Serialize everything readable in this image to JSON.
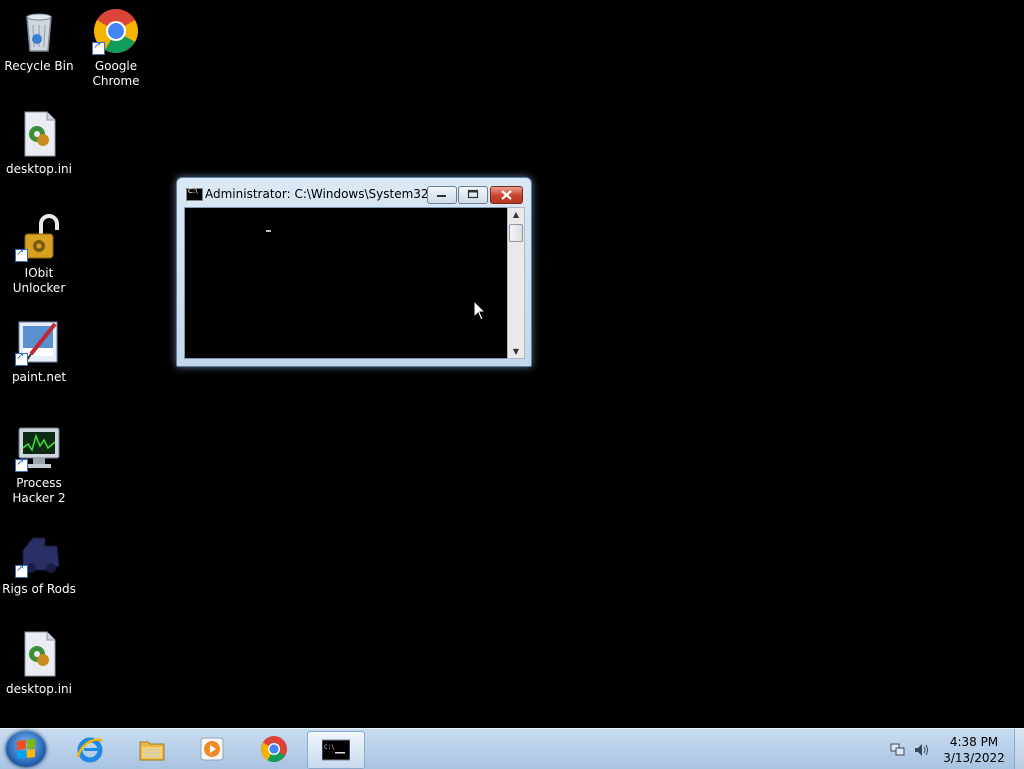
{
  "desktop": {
    "icons": [
      {
        "label": "Recycle Bin",
        "icon": "recycle-bin-icon"
      },
      {
        "label": "Google Chrome",
        "icon": "chrome-icon"
      },
      {
        "label": "desktop.ini",
        "icon": "ini-file-icon"
      },
      {
        "label": "IObit Unlocker",
        "icon": "iobit-unlocker-icon"
      },
      {
        "label": "paint.net",
        "icon": "paint-net-icon"
      },
      {
        "label": "Process Hacker 2",
        "icon": "process-hacker-icon"
      },
      {
        "label": "Rigs of Rods",
        "icon": "rigs-of-rods-icon"
      },
      {
        "label": "desktop.ini",
        "icon": "ini-file-icon"
      }
    ]
  },
  "window": {
    "title": "Administrator: C:\\Windows\\System32\\...",
    "minimize": "minimize-icon",
    "maximize": "maximize-icon",
    "close": "close-icon"
  },
  "taskbar": {
    "pinned": [
      "internet-explorer-icon",
      "file-explorer-icon",
      "media-player-icon",
      "chrome-icon",
      "command-prompt-icon"
    ],
    "active": "command-prompt-icon",
    "clock": {
      "time": "4:38 PM",
      "date": "3/13/2022"
    }
  },
  "colors": {
    "desktop_bg": "#000000",
    "taskbar": "#b9d1ea",
    "close_button": "#c8402a"
  }
}
